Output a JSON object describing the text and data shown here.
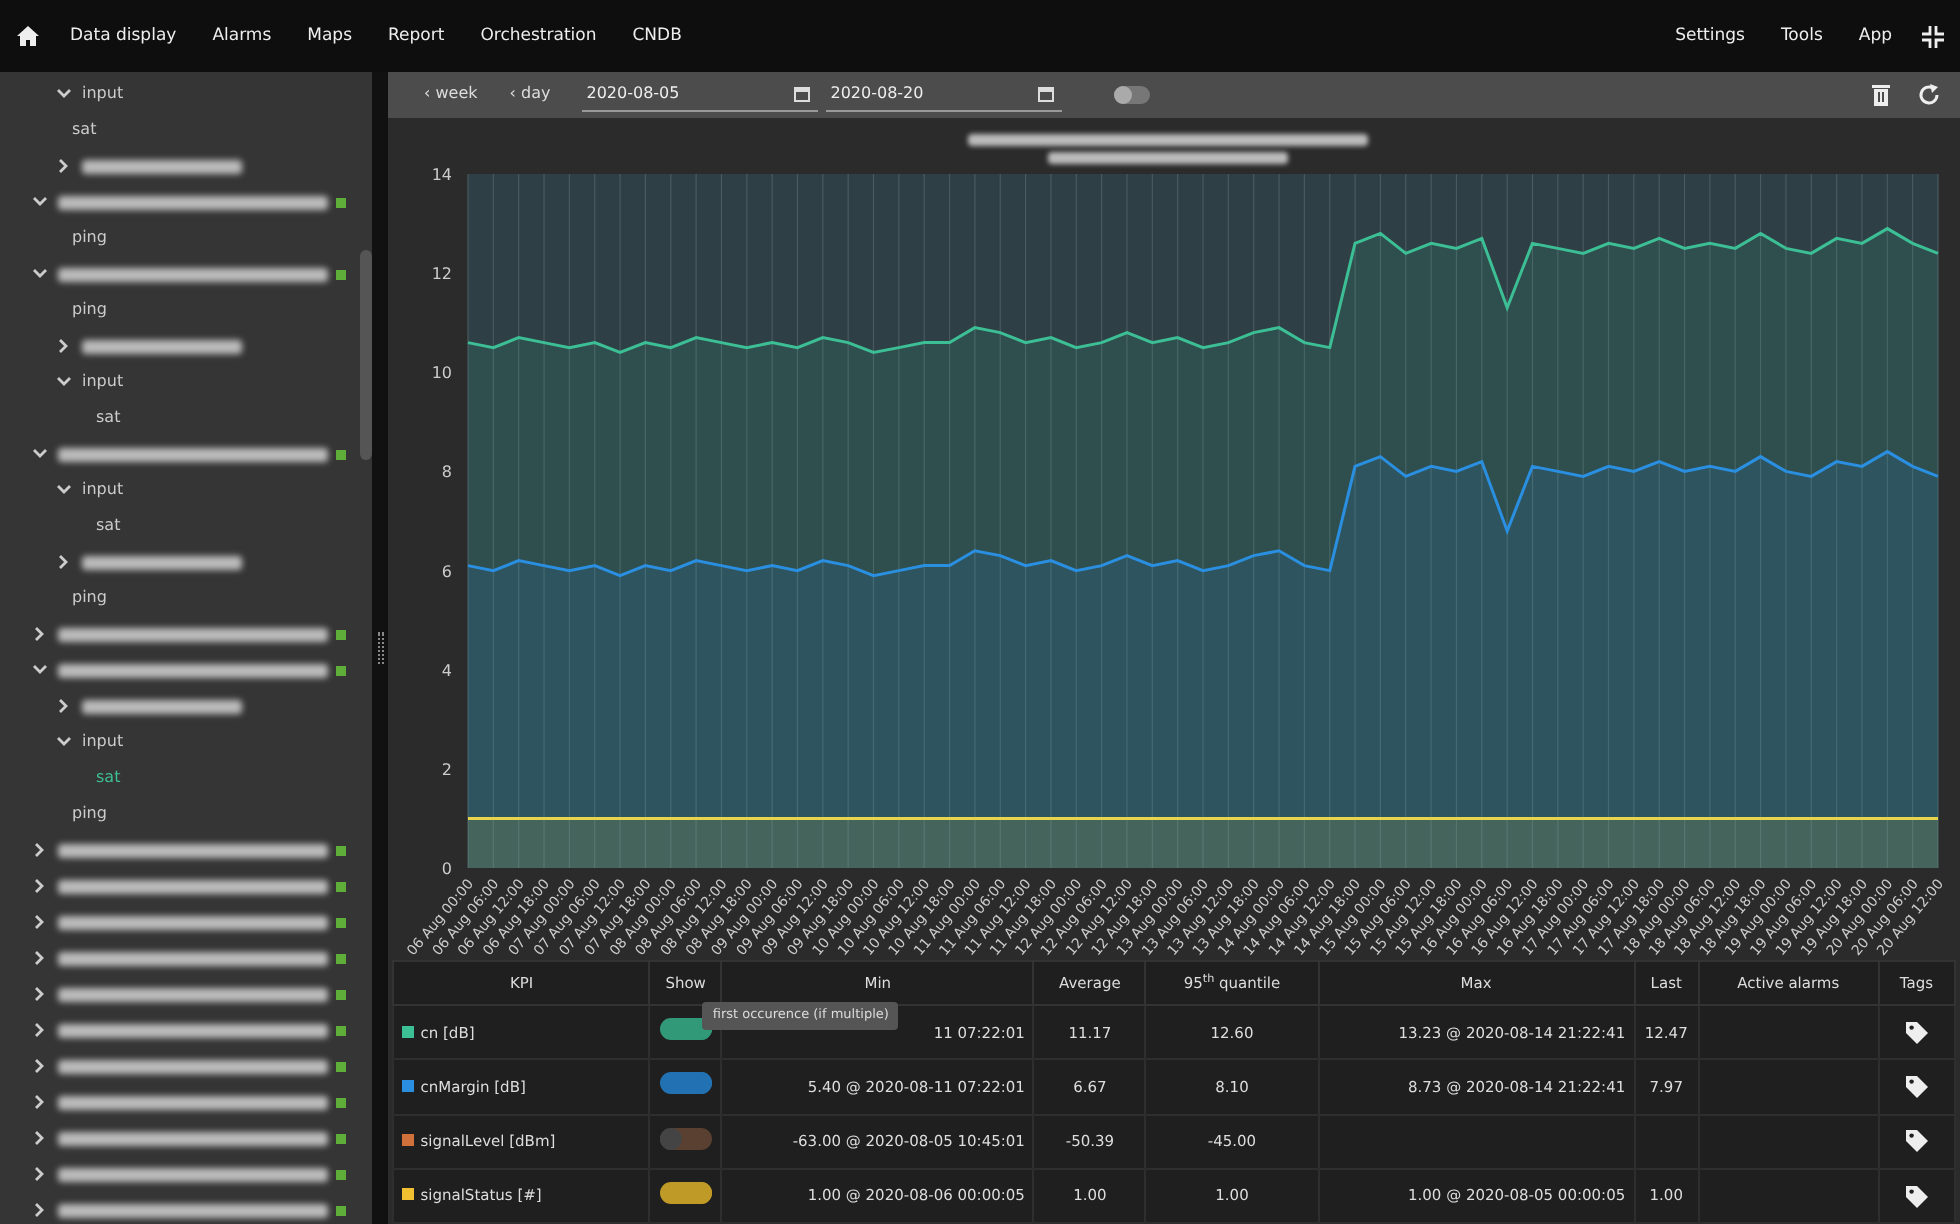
{
  "navbar": {
    "items": [
      {
        "label": "Data display",
        "selected": false
      },
      {
        "label": "Alarms",
        "selected": false
      },
      {
        "label": "Maps",
        "selected": false
      },
      {
        "label": "Report",
        "selected": false
      },
      {
        "label": "Orchestration",
        "selected": false
      },
      {
        "label": "CNDB",
        "selected": false
      }
    ],
    "right_items": [
      {
        "label": "Settings"
      },
      {
        "label": "Tools"
      },
      {
        "label": "App"
      }
    ]
  },
  "tree": [
    {
      "kind": "group",
      "label": "input",
      "expanded": true,
      "children": [
        {
          "kind": "leaf",
          "label": "sat",
          "selected": false
        }
      ]
    },
    {
      "kind": "group",
      "blurred": true,
      "expanded": false
    },
    {
      "kind": "host",
      "blurred": true,
      "expanded": true,
      "online": true,
      "children": [
        {
          "kind": "leaf",
          "label": "ping",
          "selected": false
        }
      ]
    },
    {
      "kind": "host",
      "blurred": true,
      "expanded": true,
      "online": true,
      "children": [
        {
          "kind": "leaf",
          "label": "ping",
          "selected": false
        },
        {
          "kind": "group",
          "blurred": true,
          "expanded": false
        },
        {
          "kind": "group",
          "label": "input",
          "expanded": true,
          "children": [
            {
              "kind": "leaf",
              "label": "sat",
              "selected": false
            }
          ]
        }
      ]
    },
    {
      "kind": "host",
      "blurred": true,
      "expanded": true,
      "online": true,
      "children": [
        {
          "kind": "group",
          "label": "input",
          "expanded": true,
          "children": [
            {
              "kind": "leaf",
              "label": "sat",
              "selected": false
            }
          ]
        },
        {
          "kind": "group",
          "blurred": true,
          "expanded": false
        },
        {
          "kind": "leaf",
          "label": "ping",
          "selected": false
        }
      ]
    },
    {
      "kind": "host",
      "blurred": true,
      "expanded": false,
      "online": true
    },
    {
      "kind": "host",
      "blurred": true,
      "expanded": true,
      "online": true,
      "children": [
        {
          "kind": "group",
          "blurred": true,
          "expanded": false
        },
        {
          "kind": "group",
          "label": "input",
          "expanded": true,
          "children": [
            {
              "kind": "leaf",
              "label": "sat",
              "selected": true
            }
          ]
        },
        {
          "kind": "leaf",
          "label": "ping",
          "selected": false
        }
      ]
    },
    {
      "kind": "host",
      "blurred": true,
      "expanded": false,
      "online": true
    },
    {
      "kind": "host",
      "blurred": true,
      "expanded": false,
      "online": true
    },
    {
      "kind": "host",
      "blurred": true,
      "expanded": false,
      "online": true
    },
    {
      "kind": "host",
      "blurred": true,
      "expanded": false,
      "online": true
    },
    {
      "kind": "host",
      "blurred": true,
      "expanded": false,
      "online": true
    },
    {
      "kind": "host",
      "blurred": true,
      "expanded": false,
      "online": true
    },
    {
      "kind": "host",
      "blurred": true,
      "expanded": false,
      "online": true
    },
    {
      "kind": "host",
      "blurred": true,
      "expanded": false,
      "online": true
    },
    {
      "kind": "host",
      "blurred": true,
      "expanded": false,
      "online": true
    },
    {
      "kind": "host",
      "blurred": true,
      "expanded": false,
      "online": true
    },
    {
      "kind": "host",
      "blurred": true,
      "expanded": false,
      "online": true
    }
  ],
  "toolbar": {
    "buttons": [
      {
        "label": "‹ week"
      },
      {
        "label": "‹ day"
      }
    ],
    "date_from": "2020-08-05",
    "date_to": "2020-08-20",
    "switch_on": false
  },
  "chart": {
    "chart_data": {
      "type": "area",
      "grid": true,
      "ylim": [
        0,
        14
      ],
      "yticks": [
        0,
        2,
        4,
        6,
        8,
        10,
        12,
        14
      ],
      "categories": [
        "06 Aug 00:00",
        "06 Aug 06:00",
        "06 Aug 12:00",
        "06 Aug 18:00",
        "07 Aug 00:00",
        "07 Aug 06:00",
        "07 Aug 12:00",
        "07 Aug 18:00",
        "08 Aug 00:00",
        "08 Aug 06:00",
        "08 Aug 12:00",
        "08 Aug 18:00",
        "09 Aug 00:00",
        "09 Aug 06:00",
        "09 Aug 12:00",
        "09 Aug 18:00",
        "10 Aug 00:00",
        "10 Aug 06:00",
        "10 Aug 12:00",
        "10 Aug 18:00",
        "11 Aug 00:00",
        "11 Aug 06:00",
        "11 Aug 12:00",
        "11 Aug 18:00",
        "12 Aug 00:00",
        "12 Aug 06:00",
        "12 Aug 12:00",
        "12 Aug 18:00",
        "13 Aug 00:00",
        "13 Aug 06:00",
        "13 Aug 12:00",
        "13 Aug 18:00",
        "14 Aug 00:00",
        "14 Aug 06:00",
        "14 Aug 12:00",
        "14 Aug 18:00",
        "15 Aug 00:00",
        "15 Aug 06:00",
        "15 Aug 12:00",
        "15 Aug 18:00",
        "16 Aug 00:00",
        "16 Aug 06:00",
        "16 Aug 12:00",
        "16 Aug 18:00",
        "17 Aug 00:00",
        "17 Aug 06:00",
        "17 Aug 12:00",
        "17 Aug 18:00",
        "18 Aug 00:00",
        "18 Aug 06:00",
        "18 Aug 12:00",
        "18 Aug 18:00",
        "19 Aug 00:00",
        "19 Aug 06:00",
        "19 Aug 12:00",
        "19 Aug 18:00",
        "20 Aug 00:00",
        "20 Aug 06:00",
        "20 Aug 12:00"
      ],
      "series": [
        {
          "color": "#3dbf95",
          "values": [
            10.6,
            10.5,
            10.7,
            10.6,
            10.5,
            10.6,
            10.4,
            10.6,
            10.5,
            10.7,
            10.6,
            10.5,
            10.6,
            10.5,
            10.7,
            10.6,
            10.4,
            10.5,
            10.6,
            10.6,
            10.9,
            10.8,
            10.6,
            10.7,
            10.5,
            10.6,
            10.8,
            10.6,
            10.7,
            10.5,
            10.6,
            10.8,
            10.9,
            10.6,
            10.5,
            12.6,
            12.8,
            12.4,
            12.6,
            12.5,
            12.7,
            11.3,
            12.6,
            12.5,
            12.4,
            12.6,
            12.5,
            12.7,
            12.5,
            12.6,
            12.5,
            12.8,
            12.5,
            12.4,
            12.7,
            12.6,
            12.9,
            12.6,
            12.4
          ]
        },
        {
          "color": "#2a8fe0",
          "values": [
            6.1,
            6.0,
            6.2,
            6.1,
            6.0,
            6.1,
            5.9,
            6.1,
            6.0,
            6.2,
            6.1,
            6.0,
            6.1,
            6.0,
            6.2,
            6.1,
            5.9,
            6.0,
            6.1,
            6.1,
            6.4,
            6.3,
            6.1,
            6.2,
            6.0,
            6.1,
            6.3,
            6.1,
            6.2,
            6.0,
            6.1,
            6.3,
            6.4,
            6.1,
            6.0,
            8.1,
            8.3,
            7.9,
            8.1,
            8.0,
            8.2,
            6.8,
            8.1,
            8.0,
            7.9,
            8.1,
            8.0,
            8.2,
            8.0,
            8.1,
            8.0,
            8.3,
            8.0,
            7.9,
            8.2,
            8.1,
            8.4,
            8.1,
            7.9
          ]
        },
        {
          "color": "#e8d44d",
          "values": [
            1,
            1,
            1,
            1,
            1,
            1,
            1,
            1,
            1,
            1,
            1,
            1,
            1,
            1,
            1,
            1,
            1,
            1,
            1,
            1,
            1,
            1,
            1,
            1,
            1,
            1,
            1,
            1,
            1,
            1,
            1,
            1,
            1,
            1,
            1,
            1,
            1,
            1,
            1,
            1,
            1,
            1,
            1,
            1,
            1,
            1,
            1,
            1,
            1,
            1,
            1,
            1,
            1,
            1,
            1,
            1,
            1,
            1,
            1
          ]
        }
      ]
    }
  },
  "table": {
    "columns": [
      "KPI",
      "Show",
      "Min",
      "Average",
      "95$^{th}$ quantile",
      "Max",
      "Last",
      "Active alarms",
      "Tags"
    ],
    "rows": [
      {
        "kpi": "cn [dB]",
        "color": "#3dbf95",
        "show": true,
        "min": "11 07:22:01",
        "average": "11.17",
        "quantile": "12.60",
        "max": "13.23 @ 2020-08-14 21:22:41",
        "last": "12.47"
      },
      {
        "kpi": "cnMargin [dB]",
        "color": "#2a8fe0",
        "show": true,
        "min": "5.40 @ 2020-08-11 07:22:01",
        "average": "6.67",
        "quantile": "8.10",
        "max": "8.73 @ 2020-08-14 21:22:41",
        "last": "7.97"
      },
      {
        "kpi": "signalLevel [dBm]",
        "color": "#d0703a",
        "show": false,
        "min": "-63.00 @ 2020-08-05 10:45:01",
        "average": "-50.39",
        "quantile": "-45.00"
      },
      {
        "kpi": "signalStatus [#]",
        "color": "#f0c030",
        "show": true,
        "min": "1.00 @ 2020-08-06 00:00:05",
        "average": "1.00",
        "quantile": "1.00",
        "max": "1.00 @ 2020-08-05 00:00:05",
        "last": "1.00"
      }
    ],
    "tooltip": "first occurence (if multiple)"
  }
}
